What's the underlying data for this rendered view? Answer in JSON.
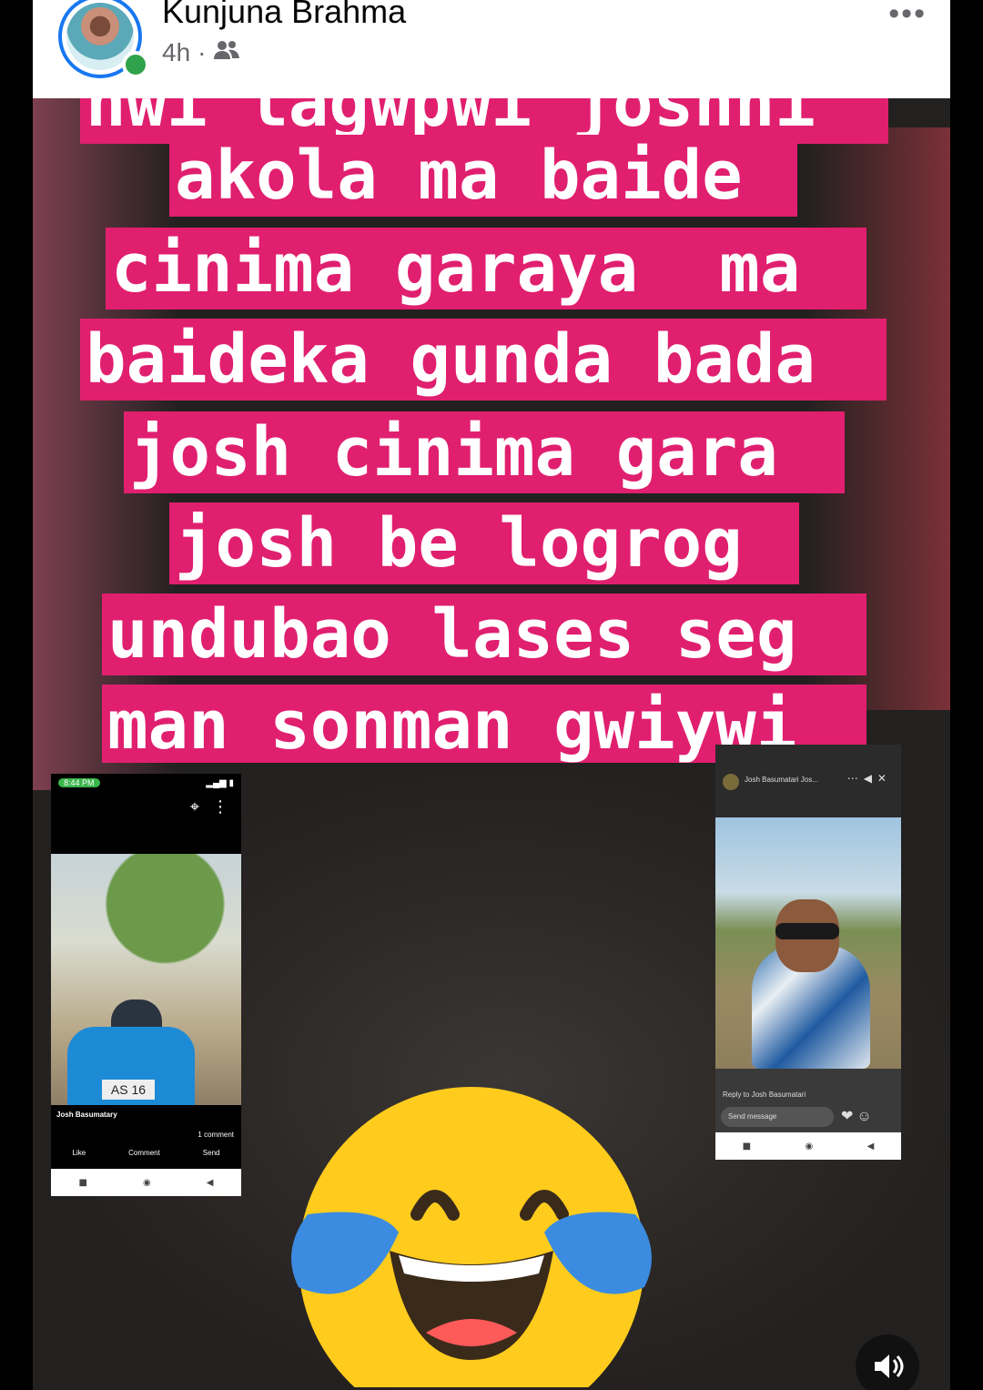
{
  "post": {
    "author": "Kunjuna Brahma",
    "time": "4h",
    "separator": "·",
    "audience_icon": "friends-icon",
    "more_label": "•••"
  },
  "caption_lines": [
    "nwi lagwpwi joshni",
    "akola ma baide",
    "cinima garaya  ma",
    "baideka gunda bada",
    "josh cinima gara",
    "josh be logrog",
    "undubao lases seg",
    "man sonman gwiywi"
  ],
  "left_screenshot": {
    "status_time": "8:44 PM",
    "plate": "AS 16",
    "name": "Josh Basumatary",
    "comments": "1 comment",
    "actions": [
      "Like",
      "Comment",
      "Send"
    ]
  },
  "right_screenshot": {
    "name": "Josh Basumatari Jos...",
    "reply_to": "Reply to Josh Basumatari",
    "message_placeholder": "Send message"
  },
  "colors": {
    "caption_bg": "#e01f6f",
    "caption_text": "#ffffff",
    "brand_blue": "#1877f2",
    "online_green": "#31a24c"
  },
  "emoji": "face-with-tears-of-joy",
  "sound_icon": "speaker-icon"
}
